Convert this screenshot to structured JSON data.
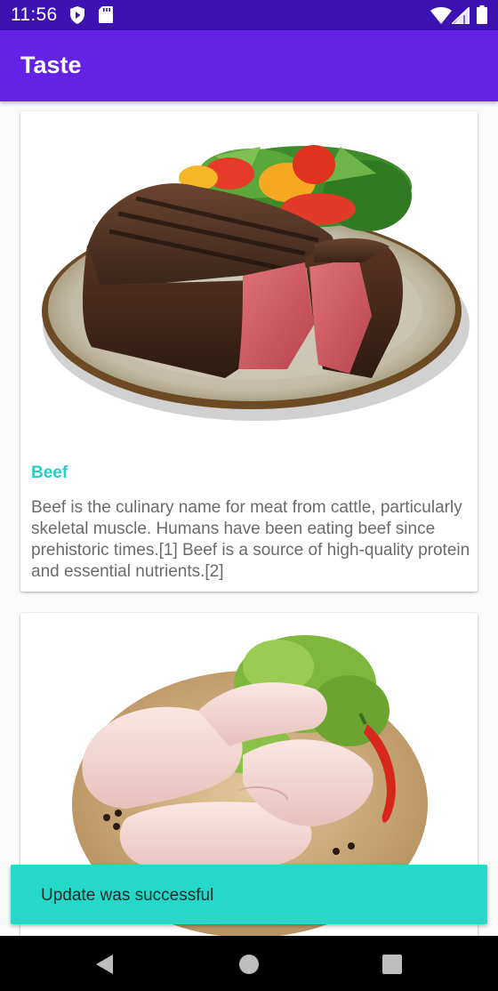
{
  "status_bar": {
    "time": "11:56",
    "left_icons": [
      "shield-play-icon",
      "sd-card-icon"
    ],
    "right_icons": [
      "wifi-icon",
      "cell-signal-icon",
      "battery-icon"
    ],
    "color": "#3d12b3"
  },
  "app_bar": {
    "title": "Taste",
    "color": "#6322e6"
  },
  "items": [
    {
      "image_icon": "steak-plate-image",
      "title": "Beef",
      "description": "Beef is the culinary name for meat from cattle, particularly skeletal muscle. Humans have been eating beef since prehistoric times.[1] Beef is a source of high-quality protein and essential nutrients.[2]"
    },
    {
      "image_icon": "chicken-board-image",
      "title": "",
      "description": ""
    }
  ],
  "snackbar": {
    "message": "Update was successful",
    "color": "#26d8c8"
  },
  "nav_bar": {
    "buttons": [
      "back-icon",
      "home-icon",
      "recents-icon"
    ]
  },
  "accent_color": "#26d0c8"
}
